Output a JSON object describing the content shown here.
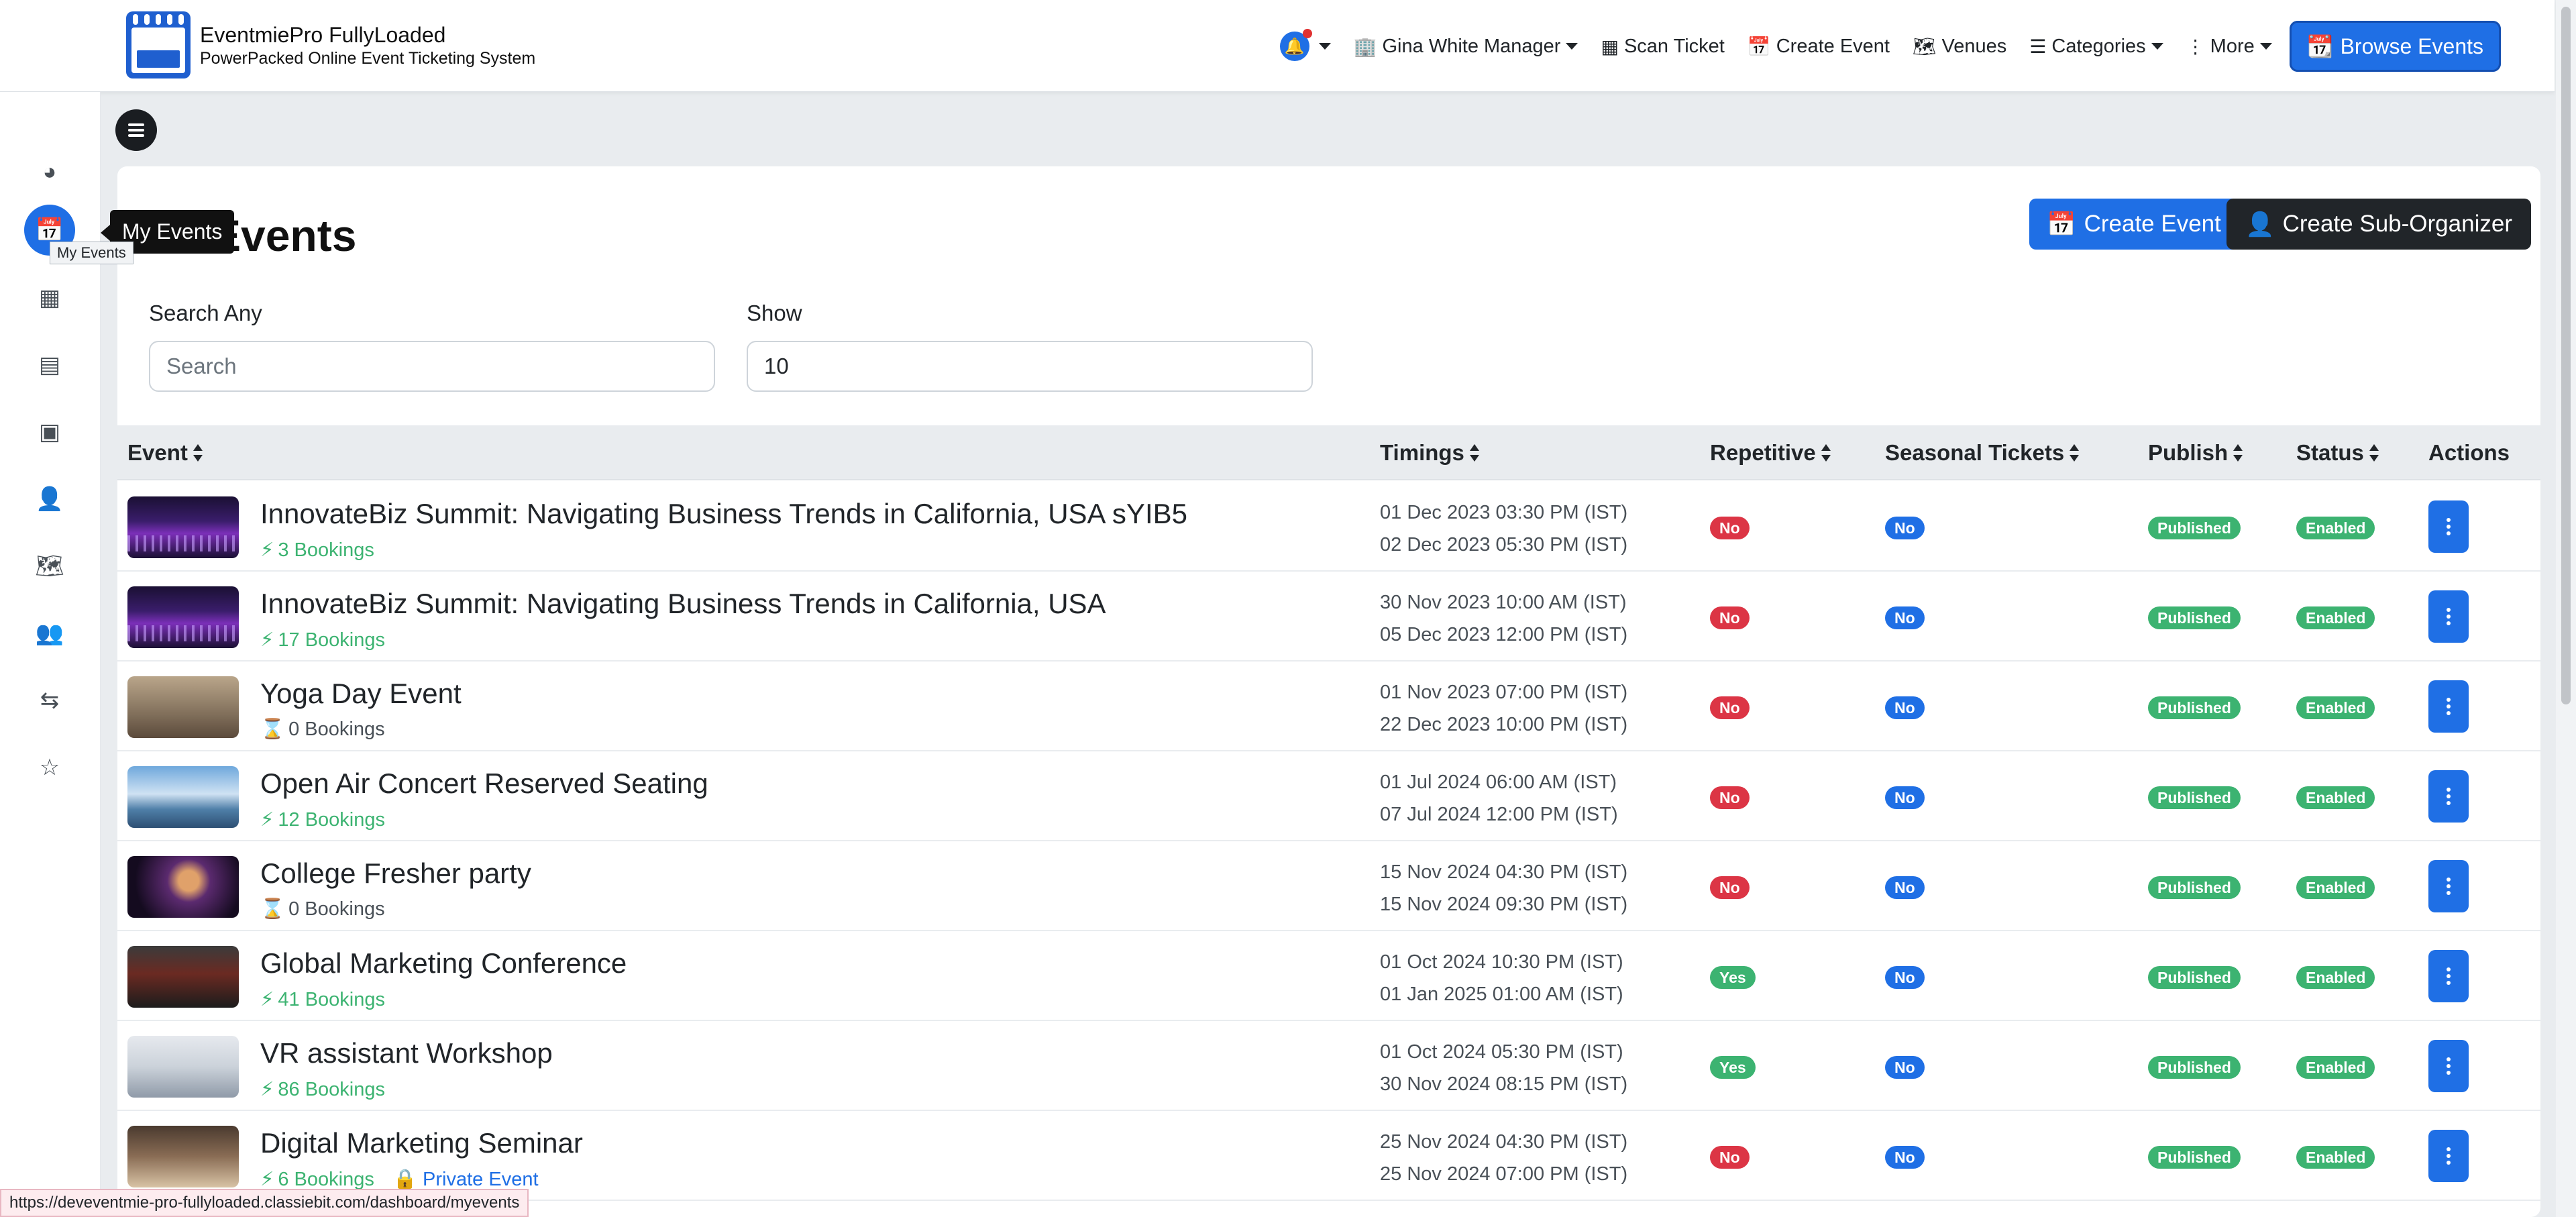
{
  "app": {
    "brand_title": "EventmiePro FullyLoaded",
    "brand_subtitle": "PowerPacked Online Event Ticketing System"
  },
  "nav": {
    "user": "Gina White Manager",
    "scan_ticket": "Scan Ticket",
    "create_event": "Create Event",
    "venues": "Venues",
    "categories": "Categories",
    "more": "More",
    "browse_events": "Browse Events"
  },
  "sidebar": {
    "tooltip": "My Events",
    "mini_tooltip": "My Events"
  },
  "page": {
    "title": "My Events",
    "title_visible": "Events",
    "create_event_btn": "Create Event",
    "create_sub_org_btn": "Create Sub-Organizer"
  },
  "filters": {
    "search_label": "Search Any",
    "search_placeholder": "Search",
    "show_label": "Show",
    "show_value": "10"
  },
  "table": {
    "headers": {
      "event": "Event",
      "timings": "Timings",
      "repetitive": "Repetitive",
      "seasonal": "Seasonal Tickets",
      "publish": "Publish",
      "status": "Status",
      "actions": "Actions"
    },
    "rows": [
      {
        "title": "InnovateBiz Summit: Navigating Business Trends in California, USA sYIB5",
        "bookings": "3 Bookings",
        "start": "01 Dec 2023 03:30 PM (IST)",
        "end": "02 Dec 2023 05:30 PM (IST)",
        "repetitive": "No",
        "seasonal": "No",
        "publish": "Published",
        "status": "Enabled",
        "private": ""
      },
      {
        "title": "InnovateBiz Summit: Navigating Business Trends in California, USA",
        "bookings": "17 Bookings",
        "start": "30 Nov 2023 10:00 AM (IST)",
        "end": "05 Dec 2023 12:00 PM (IST)",
        "repetitive": "No",
        "seasonal": "No",
        "publish": "Published",
        "status": "Enabled",
        "private": ""
      },
      {
        "title": "Yoga Day Event",
        "bookings": "0 Bookings",
        "start": "01 Nov 2023 07:00 PM (IST)",
        "end": "22 Dec 2023 10:00 PM (IST)",
        "repetitive": "No",
        "seasonal": "No",
        "publish": "Published",
        "status": "Enabled",
        "private": ""
      },
      {
        "title": "Open Air Concert Reserved Seating",
        "bookings": "12 Bookings",
        "start": "01 Jul 2024 06:00 AM (IST)",
        "end": "07 Jul 2024 12:00 PM (IST)",
        "repetitive": "No",
        "seasonal": "No",
        "publish": "Published",
        "status": "Enabled",
        "private": ""
      },
      {
        "title": "College Fresher party",
        "bookings": "0 Bookings",
        "start": "15 Nov 2024 04:30 PM (IST)",
        "end": "15 Nov 2024 09:30 PM (IST)",
        "repetitive": "No",
        "seasonal": "No",
        "publish": "Published",
        "status": "Enabled",
        "private": ""
      },
      {
        "title": "Global Marketing Conference",
        "bookings": "41 Bookings",
        "start": "01 Oct 2024 10:30 PM (IST)",
        "end": "01 Jan 2025 01:00 AM (IST)",
        "repetitive": "Yes",
        "seasonal": "No",
        "publish": "Published",
        "status": "Enabled",
        "private": ""
      },
      {
        "title": "VR assistant Workshop",
        "bookings": "86 Bookings",
        "start": "01 Oct 2024 05:30 PM (IST)",
        "end": "30 Nov 2024 08:15 PM (IST)",
        "repetitive": "Yes",
        "seasonal": "No",
        "publish": "Published",
        "status": "Enabled",
        "private": ""
      },
      {
        "title": "Digital Marketing Seminar",
        "bookings": "6 Bookings",
        "start": "25 Nov 2024 04:30 PM (IST)",
        "end": "25 Nov 2024 07:00 PM (IST)",
        "repetitive": "No",
        "seasonal": "No",
        "publish": "Published",
        "status": "Enabled",
        "private": "Private Event"
      }
    ]
  },
  "status_url": "https://deveventmie-pro-fullyloaded.classiebit.com/dashboard/myevents",
  "colors": {
    "primary": "#1f6fe5",
    "success": "#3cb371",
    "danger": "#dc3545",
    "dark": "#212529"
  }
}
